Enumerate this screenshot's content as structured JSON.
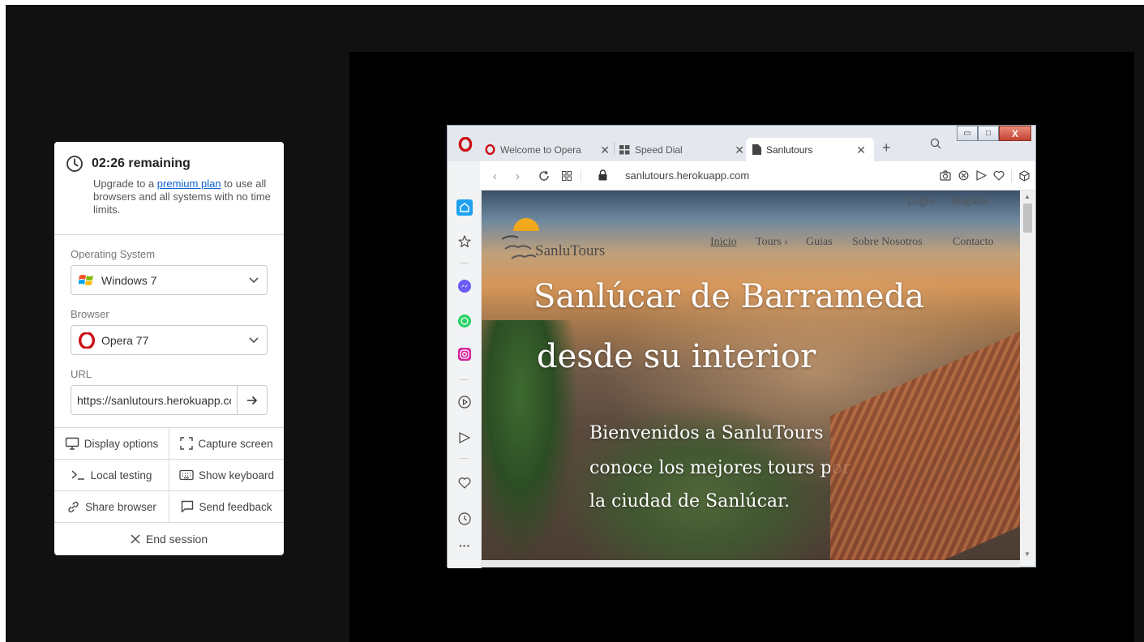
{
  "session": {
    "timer": "02:26 remaining",
    "upgrade_prefix": "Upgrade to a",
    "upgrade_link": "premium plan",
    "upgrade_suffix": "to use all browsers and all systems with no time limits."
  },
  "config": {
    "os_label": "Operating System",
    "os_value": "Windows 7",
    "browser_label": "Browser",
    "browser_value": "Opera 77",
    "url_label": "URL",
    "url_value": "https://sanlutours.herokuapp.com"
  },
  "actions": {
    "display_options": "Display options",
    "capture_screen": "Capture screen",
    "local_testing": "Local testing",
    "show_keyboard": "Show keyboard",
    "share_browser": "Share browser",
    "send_feedback": "Send feedback",
    "end_session": "End session"
  },
  "browser": {
    "tabs": [
      {
        "label": "Welcome to Opera",
        "icon": "opera-icon"
      },
      {
        "label": "Speed Dial",
        "icon": "speed-dial-icon"
      },
      {
        "label": "Sanlutours",
        "icon": "page-icon",
        "active": true
      }
    ],
    "address": "sanlutours.herokuapp.com"
  },
  "website": {
    "login": "Login",
    "register": "Register",
    "logo_text": "SanluTours",
    "menu": [
      "Inicio",
      "Tours ›",
      "Guias",
      "Sobre Nosotros",
      "Contacto"
    ],
    "hero_line1": "Sanlúcar de Barrameda",
    "hero_line2": "desde su interior",
    "sub_lines": [
      "Bienvenidos a SanluTours ,",
      "conoce los mejores tours por",
      "la ciudad de Sanlúcar."
    ]
  },
  "colors": {
    "link": "#0b5fd0",
    "opera_red": "#cc0f16",
    "background": "#111111",
    "stage": "#000000"
  }
}
